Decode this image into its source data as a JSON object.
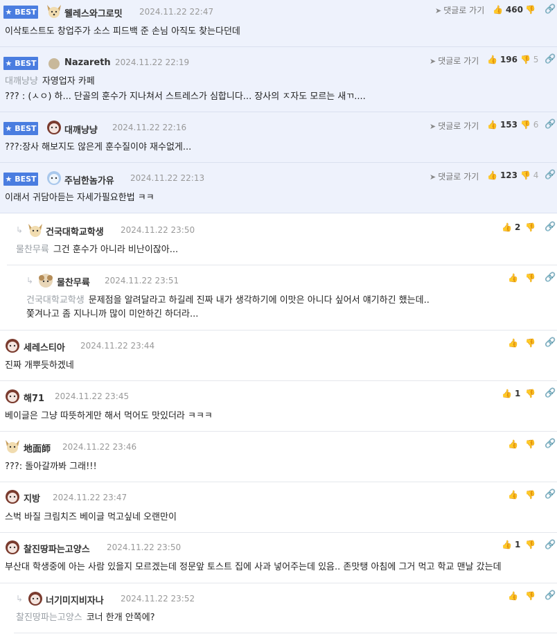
{
  "best_label": "BEST",
  "goto_label": "댓글로 가기",
  "comments": [
    {
      "nick": "웰레스와그로밋",
      "date": "2024.11.22 22:47",
      "text": "이삭토스트도 창업주가 소스 피드백 준 손님 아직도 찾는다던데",
      "up": "460",
      "down": ""
    },
    {
      "nick": "Nazareth",
      "date": "2024.11.22 22:19",
      "mention": "대깨냥냥",
      "text": "자영업자 카페",
      "text2": "??? : (ㅅㅇ) 하... 단골의 훈수가 지나쳐서 스트레스가 심합니다... 장사의 ㅈ자도 모르는 새ㄲ....",
      "up": "196",
      "down": "5"
    },
    {
      "nick": "대깨냥냥",
      "date": "2024.11.22 22:16",
      "text": "???:장사 해보지도 않은게 훈수질이야 재수없게...",
      "up": "153",
      "down": "6"
    },
    {
      "nick": "주님한놈가유",
      "date": "2024.11.22 22:13",
      "text": "이래서 귀담아듣는 자세가필요한법 ㅋㅋ",
      "up": "123",
      "down": "4"
    },
    {
      "nick": "건국대학교학생",
      "date": "2024.11.22 23:50",
      "mention": "물찬무륙",
      "text": "그건 훈수가 아니라 비난이잖아...",
      "up": "2",
      "down": ""
    },
    {
      "nick": "물찬무륙",
      "date": "2024.11.22 23:51",
      "mention": "건국대학교학생",
      "text": "문제점을 알려달라고 하길레 진짜 내가 생각하기에 이맛은 아니다 싶어서 얘기하긴 했는데..",
      "text2": "쫓겨나고 좀 지나니까 많이 미안하긴 하더라...",
      "up": "",
      "down": ""
    },
    {
      "nick": "세레스티아",
      "date": "2024.11.22 23:44",
      "text": "진짜 개뿌듯하겠네",
      "up": "",
      "down": ""
    },
    {
      "nick": "해71",
      "date": "2024.11.22 23:45",
      "text": "베이글은 그냥 따뜻하게만 해서 먹어도 맛있더라 ㅋㅋㅋ",
      "up": "1",
      "down": ""
    },
    {
      "nick": "地面師",
      "date": "2024.11.22 23:46",
      "text": "???: 돌아갈까봐 그래!!!",
      "up": "",
      "down": ""
    },
    {
      "nick": "지방",
      "date": "2024.11.22 23:47",
      "text": "스벅 바질 크림치즈 베이글 먹고싶네 오랜만이",
      "up": "",
      "down": ""
    },
    {
      "nick": "찰진땅파는고양스",
      "date": "2024.11.22 23:50",
      "text": "부산대 학생중에 아는 사람 있을지 모르겠는데 정문앞 토스트 집에 사과 넣어주는데 있음.. 존맛탱 아침에 그거 먹고 학교 맨날 갔는데",
      "up": "1",
      "down": ""
    },
    {
      "nick": "너기미지비자나",
      "date": "2024.11.22 23:52",
      "mention": "찰진땅파는고양스",
      "text": "코너 한개 안쪽에?",
      "up": "",
      "down": ""
    }
  ],
  "icons": {
    "up": "thumbs-up-icon",
    "down": "thumbs-down-icon",
    "link": "link-icon",
    "goto": "arrow-icon",
    "reply": "reply-arrow-icon"
  }
}
